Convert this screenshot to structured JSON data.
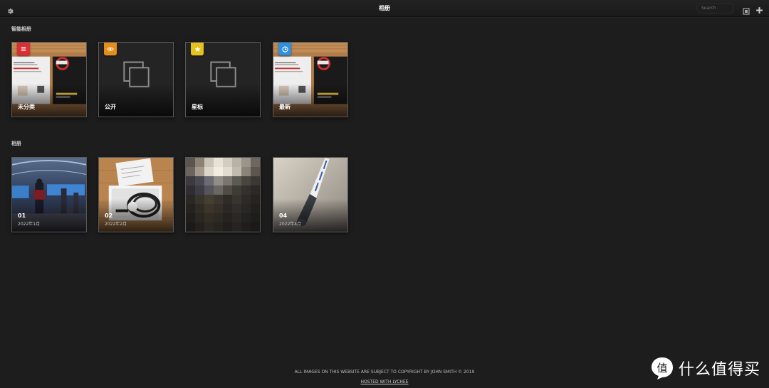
{
  "header": {
    "title": "相册",
    "search_placeholder": "Search"
  },
  "smart_albums": {
    "title": "智能相册",
    "items": [
      {
        "label": "未分类",
        "badge_icon": "list-icon",
        "badge_color": "#d92f35"
      },
      {
        "label": "公开",
        "badge_icon": "eye-icon",
        "badge_color": "#e48f1b"
      },
      {
        "label": "星标",
        "badge_icon": "star-icon",
        "badge_color": "#e6c21a"
      },
      {
        "label": "最新",
        "badge_icon": "clock-icon",
        "badge_color": "#2f8fe0"
      }
    ]
  },
  "albums": {
    "title": "相册",
    "items": [
      {
        "label": "01",
        "date": "2022年1月"
      },
      {
        "label": "02",
        "date": "2022年2月"
      },
      {
        "label": "",
        "date": ""
      },
      {
        "label": "04",
        "date": "2022年4月"
      }
    ]
  },
  "footer": {
    "copyright": "ALL IMAGES ON THIS WEBSITE ARE SUBJECT TO COPYRIGHT BY JOHN SMITH © 2019",
    "hosted": "HOSTED WITH LYCHEE"
  },
  "watermark": {
    "symbol": "值",
    "text": "什么值得买"
  },
  "colors": {
    "background": "#1d1d1d",
    "header": "#1f1f1f",
    "border": "#5a5a5a"
  }
}
